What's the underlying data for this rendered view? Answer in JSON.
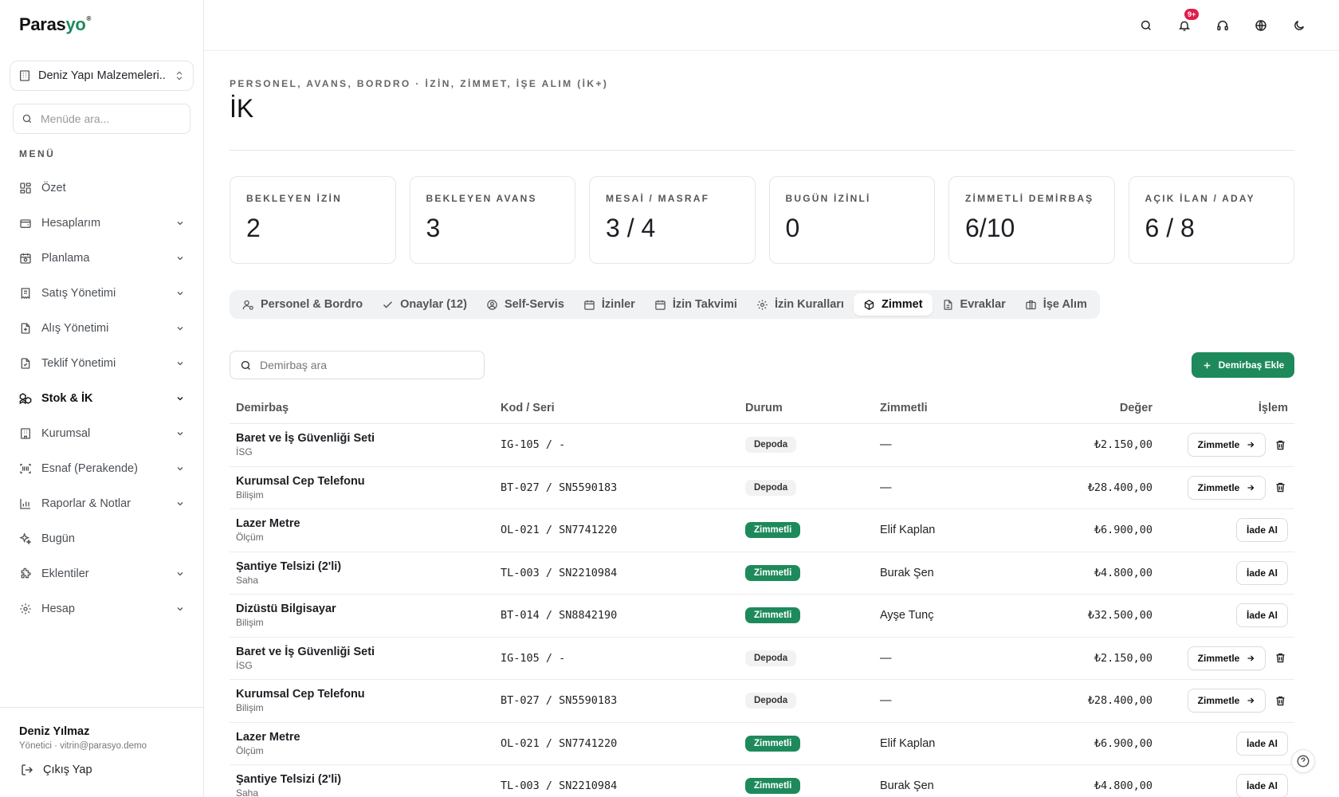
{
  "brand": {
    "name_main": "Paras",
    "name_accent": "yo",
    "mark": "®"
  },
  "company": {
    "name": "Deniz Yapı Malzemeleri..."
  },
  "menu_search": {
    "placeholder": "Menüde ara..."
  },
  "menu_title": "MENÜ",
  "menu": [
    {
      "label": "Özet",
      "icon": "dashboard-icon"
    },
    {
      "label": "Hesaplarım",
      "icon": "wallet-icon"
    },
    {
      "label": "Planlama",
      "icon": "calendar-clock-icon"
    },
    {
      "label": "Satış Yönetimi",
      "icon": "receipt-icon"
    },
    {
      "label": "Alış Yönetimi",
      "icon": "file-plus-icon"
    },
    {
      "label": "Teklif Yönetimi",
      "icon": "file-check-icon"
    },
    {
      "label": "Stok & İK",
      "icon": "boxes-icon"
    },
    {
      "label": "Kurumsal",
      "icon": "building-icon"
    },
    {
      "label": "Esnaf (Perakende)",
      "icon": "barcode-icon"
    },
    {
      "label": "Raporlar & Notlar",
      "icon": "bar-chart-icon"
    },
    {
      "label": "Bugün",
      "icon": "sparkles-icon"
    },
    {
      "label": "Eklentiler",
      "icon": "puzzle-icon"
    },
    {
      "label": "Hesap",
      "icon": "gear-icon"
    }
  ],
  "user": {
    "name": "Deniz Yılmaz",
    "role": "Yönetici · vitrin@parasyo.demo",
    "logout": "Çıkış Yap"
  },
  "topbar": {
    "notification_badge": "9+"
  },
  "page": {
    "eyebrow": "PERSONEL, AVANS, BORDRO · İZİN, ZİMMET, İŞE ALIM (İK+)",
    "title": "İK"
  },
  "stats": [
    {
      "label": "BEKLEYEN İZİN",
      "value": "2"
    },
    {
      "label": "BEKLEYEN AVANS",
      "value": "3"
    },
    {
      "label": "MESAİ / MASRAF",
      "value": "3 / 4"
    },
    {
      "label": "BUGÜN İZİNLİ",
      "value": "0"
    },
    {
      "label": "ZİMMETLİ DEMİRBAŞ",
      "value": "6/10"
    },
    {
      "label": "AÇIK İLAN / ADAY",
      "value": "6 / 8"
    }
  ],
  "tabs": [
    {
      "label": "Personel & Bordro",
      "icon": "user-cog-icon"
    },
    {
      "label": "Onaylar (12)",
      "icon": "check-icon"
    },
    {
      "label": "Self-Servis",
      "icon": "user-circle-icon"
    },
    {
      "label": "İzinler",
      "icon": "calendar-icon"
    },
    {
      "label": "İzin Takvimi",
      "icon": "calendar-icon"
    },
    {
      "label": "İzin Kuralları",
      "icon": "gear-icon"
    },
    {
      "label": "Zimmet",
      "icon": "package-icon"
    },
    {
      "label": "Evraklar",
      "icon": "file-text-icon"
    },
    {
      "label": "İşe Alım",
      "icon": "briefcase-icon"
    }
  ],
  "table_search": {
    "placeholder": "Demirbaş ara"
  },
  "add_button": "Demirbaş Ekle",
  "columns": {
    "item": "Demirbaş",
    "code": "Kod / Seri",
    "status": "Durum",
    "assignee": "Zimmetli",
    "value": "Değer",
    "action": "İşlem"
  },
  "rows": [
    {
      "name": "Baret ve İş Güvenliği Seti",
      "category": "İSG",
      "code": "IG-105 / -",
      "status": "Depoda",
      "assignee": "—",
      "value": "₺2.150,00",
      "action": "Zimmetle"
    },
    {
      "name": "Kurumsal Cep Telefonu",
      "category": "Bilişim",
      "code": "BT-027 / SN5590183",
      "status": "Depoda",
      "assignee": "—",
      "value": "₺28.400,00",
      "action": "Zimmetle"
    },
    {
      "name": "Lazer Metre",
      "category": "Ölçüm",
      "code": "OL-021 / SN7741220",
      "status": "Zimmetli",
      "assignee": "Elif Kaplan",
      "value": "₺6.900,00",
      "action": "İade Al"
    },
    {
      "name": "Şantiye Telsizi (2'li)",
      "category": "Saha",
      "code": "TL-003 / SN2210984",
      "status": "Zimmetli",
      "assignee": "Burak Şen",
      "value": "₺4.800,00",
      "action": "İade Al"
    },
    {
      "name": "Dizüstü Bilgisayar",
      "category": "Bilişim",
      "code": "BT-014 / SN8842190",
      "status": "Zimmetli",
      "assignee": "Ayşe Tunç",
      "value": "₺32.500,00",
      "action": "İade Al"
    },
    {
      "name": "Baret ve İş Güvenliği Seti",
      "category": "İSG",
      "code": "IG-105 / -",
      "status": "Depoda",
      "assignee": "—",
      "value": "₺2.150,00",
      "action": "Zimmetle"
    },
    {
      "name": "Kurumsal Cep Telefonu",
      "category": "Bilişim",
      "code": "BT-027 / SN5590183",
      "status": "Depoda",
      "assignee": "—",
      "value": "₺28.400,00",
      "action": "Zimmetle"
    },
    {
      "name": "Lazer Metre",
      "category": "Ölçüm",
      "code": "OL-021 / SN7741220",
      "status": "Zimmetli",
      "assignee": "Elif Kaplan",
      "value": "₺6.900,00",
      "action": "İade Al"
    },
    {
      "name": "Şantiye Telsizi (2'li)",
      "category": "Saha",
      "code": "TL-003 / SN2210984",
      "status": "Zimmetli",
      "assignee": "Burak Şen",
      "value": "₺4.800,00",
      "action": "İade Al"
    }
  ],
  "colors": {
    "accent": "#1e8a5c",
    "badge": "#e11d48"
  }
}
